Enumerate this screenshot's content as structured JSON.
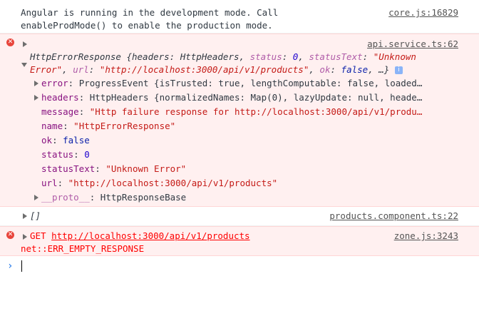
{
  "console": {
    "info_message": {
      "line1": "Angular is running in the development mode. Call",
      "line2": "enableProdMode() to enable the production mode.",
      "source": "core.js:16829"
    },
    "http_error": {
      "source": "api.service.ts:62",
      "header_line1": {
        "type": "HttpErrorResponse {headers: HttpHeaders, ",
        "status_key": "status",
        "status_val": "0",
        "status_text_key": "statusText",
        "status_text_val": "\"Unknown"
      },
      "header_line2": {
        "status_text_cont": "Error\"",
        "url_key": "url",
        "url_val": "\"http://localhost:3000/api/v1/products\"",
        "ok_key": "ok",
        "ok_val": "false",
        "tail": ", …}",
        "info_icon": "i"
      },
      "properties": [
        {
          "key": "error",
          "value": "ProgressEvent {isTrusted: true, lengthComputable: false, loaded…",
          "expandable": true
        },
        {
          "key": "headers",
          "value": "HttpHeaders {normalizedNames: Map(0), lazyUpdate: null, heade…",
          "expandable": true
        },
        {
          "key": "message",
          "value": "\"Http failure response for http://localhost:3000/api/v1/produ…",
          "expandable": false
        },
        {
          "key": "name",
          "value": "\"HttpErrorResponse\"",
          "expandable": false
        },
        {
          "key": "ok",
          "value": "false",
          "expandable": false
        },
        {
          "key": "status",
          "value": "0",
          "expandable": false
        },
        {
          "key": "statusText",
          "value": "\"Unknown Error\"",
          "expandable": false
        },
        {
          "key": "url",
          "value": "\"http://localhost:3000/api/v1/products\"",
          "expandable": false
        },
        {
          "key": "__proto__",
          "value": "HttpResponseBase",
          "expandable": true
        }
      ]
    },
    "array_log": {
      "value": "[]",
      "source": "products.component.ts:22"
    },
    "network_error": {
      "method": "GET",
      "url": "http://localhost:3000/api/v1/products",
      "detail": "net::ERR_EMPTY_RESPONSE",
      "source": "zone.js:3243"
    },
    "prompt_symbol": "›"
  },
  "colors": {
    "error_bg": "#fff0f0",
    "error_text": "#ff0000",
    "prompt": "#1a73e8"
  }
}
